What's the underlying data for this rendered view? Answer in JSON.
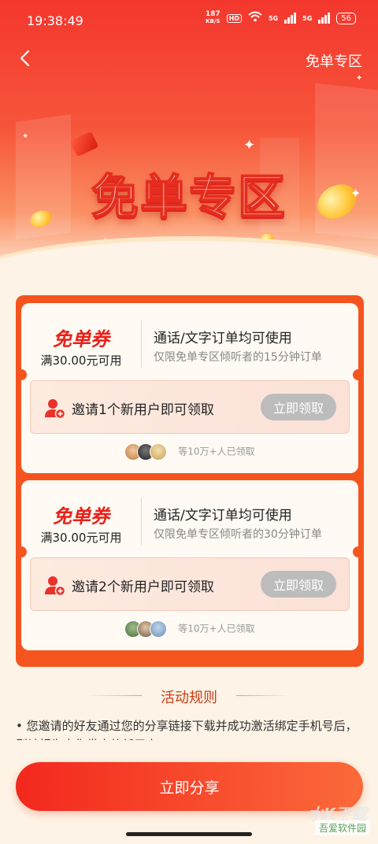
{
  "status_bar": {
    "time": "19:38:49",
    "net_speed_value": "187",
    "net_speed_unit": "KB/S",
    "hd_badge": "HD",
    "signal_1": "5G",
    "signal_2": "5G",
    "battery": "56"
  },
  "nav": {
    "back_icon": "chevron-left-icon",
    "title": "免单专区"
  },
  "hero": {
    "title": "免单专区"
  },
  "coupons": [
    {
      "name": "免单券",
      "threshold": "满30.00元可用",
      "usage_main": "通话/文字订单均可使用",
      "usage_sub": "仅限免单专区倾听者的15分钟订单",
      "invite_text": "邀请1个新用户即可领取",
      "claim_label": "立即领取",
      "claimed_text": "等10万+人已领取"
    },
    {
      "name": "免单券",
      "threshold": "满30.00元可用",
      "usage_main": "通话/文字订单均可使用",
      "usage_sub": "仅限免单专区倾听者的30分钟订单",
      "invite_text": "邀请2个新用户即可领取",
      "claim_label": "立即领取",
      "claimed_text": "等10万+人已领取"
    }
  ],
  "rules": {
    "title": "活动规则",
    "items": [
      "• 您邀请的好友通过您的分享链接下载并成功激活绑定手机号后，则被视为由您带来的新用户。"
    ]
  },
  "share_button": "立即分享",
  "watermark": {
    "main": "水K下载",
    "sub": "吾爱软件园"
  },
  "colors": {
    "brand_red": "#f4372e",
    "container_orange": "#f5541f",
    "coupon_red": "#e8211b",
    "disabled_button": "#bdbcbc",
    "page_bg": "#fdf3e6"
  }
}
